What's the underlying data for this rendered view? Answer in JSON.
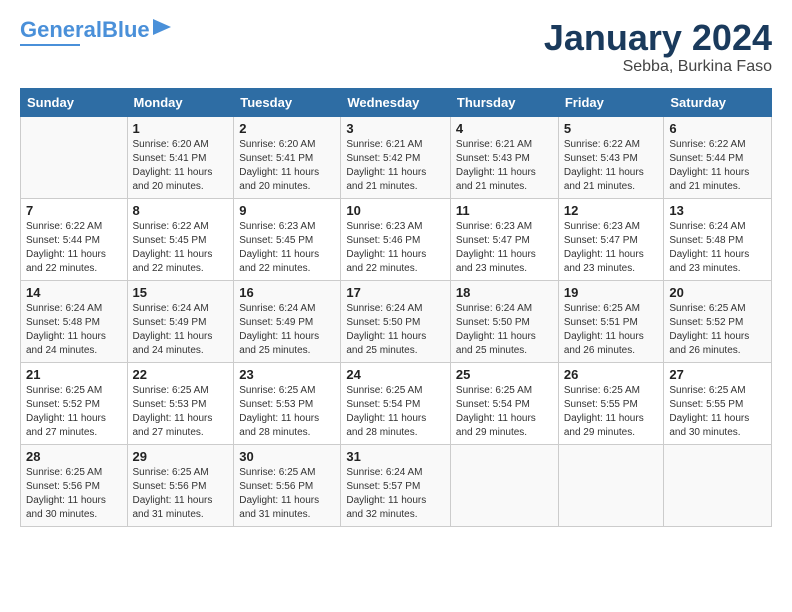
{
  "header": {
    "logo_main": "General",
    "logo_sub": "Blue",
    "month_title": "January 2024",
    "location": "Sebba, Burkina Faso"
  },
  "days_of_week": [
    "Sunday",
    "Monday",
    "Tuesday",
    "Wednesday",
    "Thursday",
    "Friday",
    "Saturday"
  ],
  "weeks": [
    [
      {
        "day": "",
        "info": ""
      },
      {
        "day": "1",
        "info": "Sunrise: 6:20 AM\nSunset: 5:41 PM\nDaylight: 11 hours\nand 20 minutes."
      },
      {
        "day": "2",
        "info": "Sunrise: 6:20 AM\nSunset: 5:41 PM\nDaylight: 11 hours\nand 20 minutes."
      },
      {
        "day": "3",
        "info": "Sunrise: 6:21 AM\nSunset: 5:42 PM\nDaylight: 11 hours\nand 21 minutes."
      },
      {
        "day": "4",
        "info": "Sunrise: 6:21 AM\nSunset: 5:43 PM\nDaylight: 11 hours\nand 21 minutes."
      },
      {
        "day": "5",
        "info": "Sunrise: 6:22 AM\nSunset: 5:43 PM\nDaylight: 11 hours\nand 21 minutes."
      },
      {
        "day": "6",
        "info": "Sunrise: 6:22 AM\nSunset: 5:44 PM\nDaylight: 11 hours\nand 21 minutes."
      }
    ],
    [
      {
        "day": "7",
        "info": "Sunrise: 6:22 AM\nSunset: 5:44 PM\nDaylight: 11 hours\nand 22 minutes."
      },
      {
        "day": "8",
        "info": "Sunrise: 6:22 AM\nSunset: 5:45 PM\nDaylight: 11 hours\nand 22 minutes."
      },
      {
        "day": "9",
        "info": "Sunrise: 6:23 AM\nSunset: 5:45 PM\nDaylight: 11 hours\nand 22 minutes."
      },
      {
        "day": "10",
        "info": "Sunrise: 6:23 AM\nSunset: 5:46 PM\nDaylight: 11 hours\nand 22 minutes."
      },
      {
        "day": "11",
        "info": "Sunrise: 6:23 AM\nSunset: 5:47 PM\nDaylight: 11 hours\nand 23 minutes."
      },
      {
        "day": "12",
        "info": "Sunrise: 6:23 AM\nSunset: 5:47 PM\nDaylight: 11 hours\nand 23 minutes."
      },
      {
        "day": "13",
        "info": "Sunrise: 6:24 AM\nSunset: 5:48 PM\nDaylight: 11 hours\nand 23 minutes."
      }
    ],
    [
      {
        "day": "14",
        "info": "Sunrise: 6:24 AM\nSunset: 5:48 PM\nDaylight: 11 hours\nand 24 minutes."
      },
      {
        "day": "15",
        "info": "Sunrise: 6:24 AM\nSunset: 5:49 PM\nDaylight: 11 hours\nand 24 minutes."
      },
      {
        "day": "16",
        "info": "Sunrise: 6:24 AM\nSunset: 5:49 PM\nDaylight: 11 hours\nand 25 minutes."
      },
      {
        "day": "17",
        "info": "Sunrise: 6:24 AM\nSunset: 5:50 PM\nDaylight: 11 hours\nand 25 minutes."
      },
      {
        "day": "18",
        "info": "Sunrise: 6:24 AM\nSunset: 5:50 PM\nDaylight: 11 hours\nand 25 minutes."
      },
      {
        "day": "19",
        "info": "Sunrise: 6:25 AM\nSunset: 5:51 PM\nDaylight: 11 hours\nand 26 minutes."
      },
      {
        "day": "20",
        "info": "Sunrise: 6:25 AM\nSunset: 5:52 PM\nDaylight: 11 hours\nand 26 minutes."
      }
    ],
    [
      {
        "day": "21",
        "info": "Sunrise: 6:25 AM\nSunset: 5:52 PM\nDaylight: 11 hours\nand 27 minutes."
      },
      {
        "day": "22",
        "info": "Sunrise: 6:25 AM\nSunset: 5:53 PM\nDaylight: 11 hours\nand 27 minutes."
      },
      {
        "day": "23",
        "info": "Sunrise: 6:25 AM\nSunset: 5:53 PM\nDaylight: 11 hours\nand 28 minutes."
      },
      {
        "day": "24",
        "info": "Sunrise: 6:25 AM\nSunset: 5:54 PM\nDaylight: 11 hours\nand 28 minutes."
      },
      {
        "day": "25",
        "info": "Sunrise: 6:25 AM\nSunset: 5:54 PM\nDaylight: 11 hours\nand 29 minutes."
      },
      {
        "day": "26",
        "info": "Sunrise: 6:25 AM\nSunset: 5:55 PM\nDaylight: 11 hours\nand 29 minutes."
      },
      {
        "day": "27",
        "info": "Sunrise: 6:25 AM\nSunset: 5:55 PM\nDaylight: 11 hours\nand 30 minutes."
      }
    ],
    [
      {
        "day": "28",
        "info": "Sunrise: 6:25 AM\nSunset: 5:56 PM\nDaylight: 11 hours\nand 30 minutes."
      },
      {
        "day": "29",
        "info": "Sunrise: 6:25 AM\nSunset: 5:56 PM\nDaylight: 11 hours\nand 31 minutes."
      },
      {
        "day": "30",
        "info": "Sunrise: 6:25 AM\nSunset: 5:56 PM\nDaylight: 11 hours\nand 31 minutes."
      },
      {
        "day": "31",
        "info": "Sunrise: 6:24 AM\nSunset: 5:57 PM\nDaylight: 11 hours\nand 32 minutes."
      },
      {
        "day": "",
        "info": ""
      },
      {
        "day": "",
        "info": ""
      },
      {
        "day": "",
        "info": ""
      }
    ]
  ]
}
